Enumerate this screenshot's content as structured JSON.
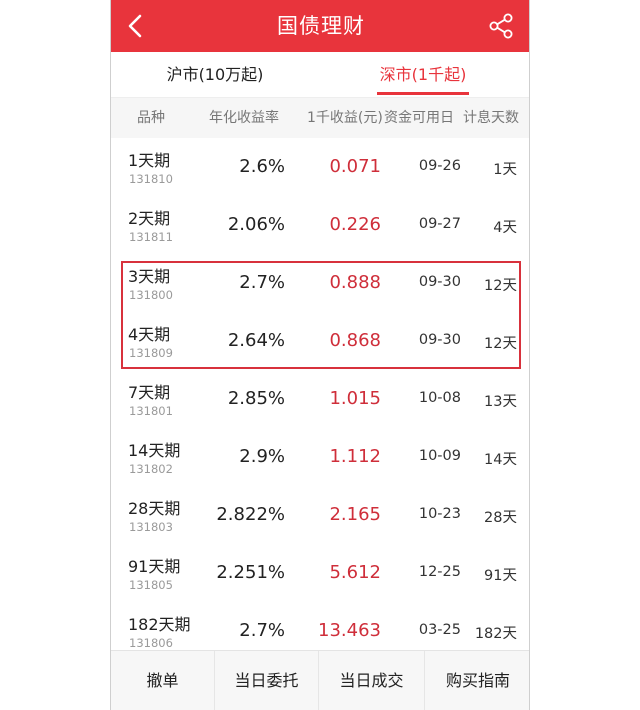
{
  "header": {
    "title": "国债理财",
    "back_icon": "chevron-left-icon",
    "share_icon": "share-icon",
    "bg_color": "#e8343c"
  },
  "tabs": [
    {
      "label": "沪市(10万起)",
      "active": false
    },
    {
      "label": "深市(1千起)",
      "active": true
    }
  ],
  "columns": [
    "品种",
    "年化收益率",
    "1千收益(元)",
    "资金可用日",
    "计息天数"
  ],
  "rows": [
    {
      "name": "1天期",
      "code": "131810",
      "rate": "2.6%",
      "income": "0.071",
      "date": "09-26",
      "days": "1天"
    },
    {
      "name": "2天期",
      "code": "131811",
      "rate": "2.06%",
      "income": "0.226",
      "date": "09-27",
      "days": "4天"
    },
    {
      "name": "3天期",
      "code": "131800",
      "rate": "2.7%",
      "income": "0.888",
      "date": "09-30",
      "days": "12天"
    },
    {
      "name": "4天期",
      "code": "131809",
      "rate": "2.64%",
      "income": "0.868",
      "date": "09-30",
      "days": "12天"
    },
    {
      "name": "7天期",
      "code": "131801",
      "rate": "2.85%",
      "income": "1.015",
      "date": "10-08",
      "days": "13天"
    },
    {
      "name": "14天期",
      "code": "131802",
      "rate": "2.9%",
      "income": "1.112",
      "date": "10-09",
      "days": "14天"
    },
    {
      "name": "28天期",
      "code": "131803",
      "rate": "2.822%",
      "income": "2.165",
      "date": "10-23",
      "days": "28天"
    },
    {
      "name": "91天期",
      "code": "131805",
      "rate": "2.251%",
      "income": "5.612",
      "date": "12-25",
      "days": "91天"
    },
    {
      "name": "182天期",
      "code": "131806",
      "rate": "2.7%",
      "income": "13.463",
      "date": "03-25",
      "days": "182天"
    }
  ],
  "bottom_bar": [
    "撤单",
    "当日委托",
    "当日成交",
    "购买指南"
  ],
  "colors": {
    "accent": "#e8343c",
    "income_text": "#cf2e3a",
    "highlight_border": "#d8313c"
  }
}
